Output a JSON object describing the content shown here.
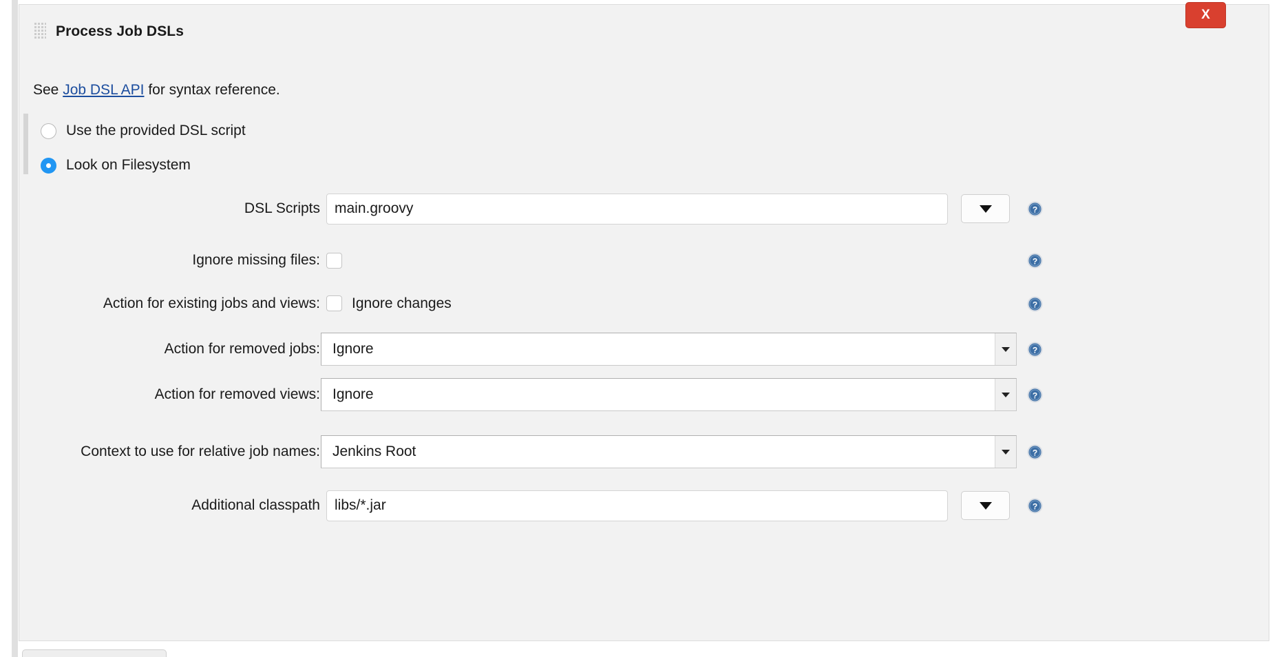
{
  "panel": {
    "title": "Process Job DSLs",
    "drag_handle_icon": "drag-grip-icon",
    "close_label": "X"
  },
  "intro": {
    "prefix": "See ",
    "link_text": "Job DSL API",
    "suffix": " for syntax reference."
  },
  "source_mode": {
    "options": [
      {
        "label": "Use the provided DSL script",
        "selected": false
      },
      {
        "label": "Look on Filesystem",
        "selected": true
      }
    ]
  },
  "fields": {
    "dsl_scripts": {
      "label": "DSL Scripts",
      "value": "main.groovy",
      "combo_icon": "triangle-down-icon",
      "help_icon": "help-question-icon"
    },
    "ignore_missing_files": {
      "label": "Ignore missing files:",
      "checked": false,
      "help_icon": "help-question-icon"
    },
    "action_existing": {
      "label": "Action for existing jobs and views:",
      "checkbox_label": "Ignore changes",
      "checked": false,
      "help_icon": "help-question-icon"
    },
    "action_removed_jobs": {
      "label": "Action for removed jobs:",
      "value": "Ignore",
      "help_icon": "help-question-icon"
    },
    "action_removed_views": {
      "label": "Action for removed views:",
      "value": "Ignore",
      "help_icon": "help-question-icon"
    },
    "context_relative": {
      "label": "Context to use for relative job names:",
      "value": "Jenkins Root",
      "help_icon": "help-question-icon"
    },
    "additional_classpath": {
      "label": "Additional classpath",
      "value": "libs/*.jar",
      "combo_icon": "triangle-down-icon",
      "help_icon": "help-question-icon"
    }
  },
  "colors": {
    "panel_background": "#f2f2f2",
    "close_button": "#d9402f",
    "radio_selected": "#2196f3",
    "link": "#1c4d9e",
    "help_icon": "#3c6ea5"
  }
}
